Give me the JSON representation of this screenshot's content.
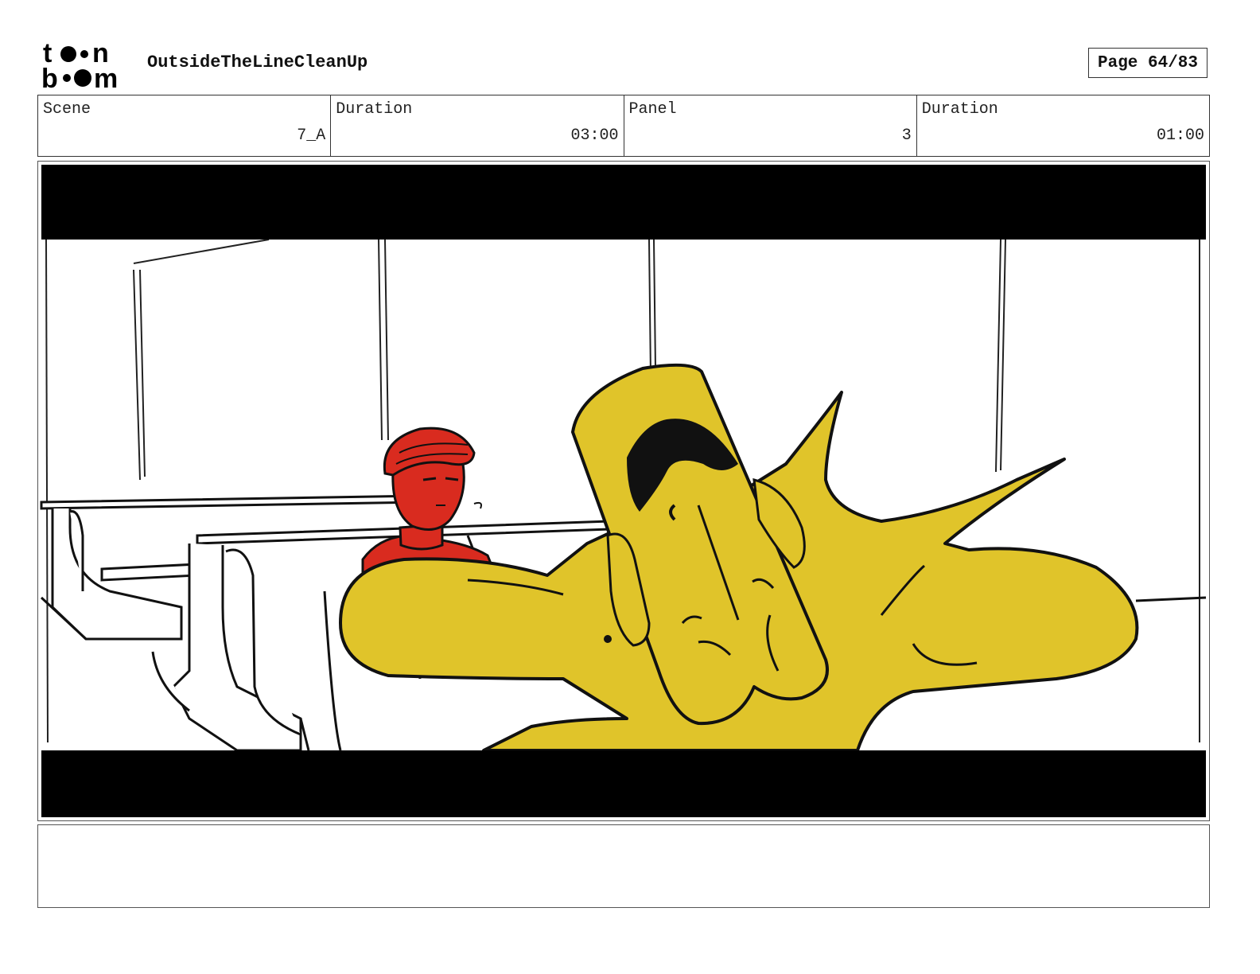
{
  "header": {
    "logo_alt": "toon boom",
    "project_title": "OutsideTheLineCleanUp",
    "page_label": "Page 64/83"
  },
  "info": {
    "scene_label": "Scene",
    "scene_value": "7_A",
    "scene_duration_label": "Duration",
    "scene_duration_value": "03:00",
    "panel_label": "Panel",
    "panel_value": "3",
    "panel_duration_label": "Duration",
    "panel_duration_value": "01:00"
  },
  "colors": {
    "character_yellow": "#e0c42a",
    "character_red": "#d92b1f",
    "letterbox": "#000000"
  },
  "notes": {
    "text": ""
  }
}
